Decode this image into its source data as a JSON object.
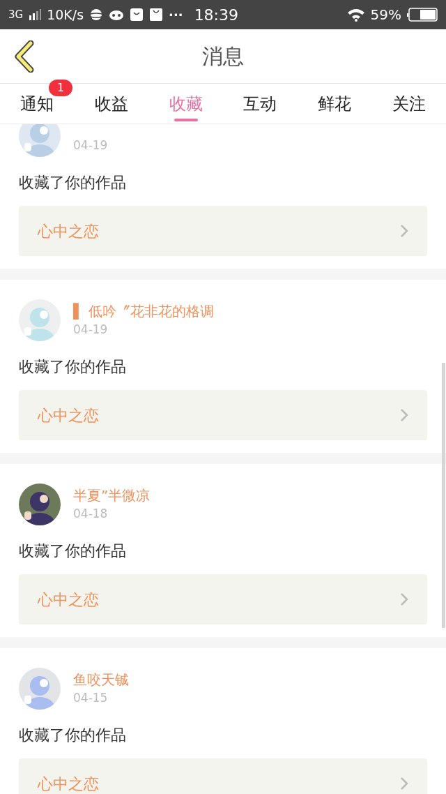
{
  "status_bar": {
    "network": "3G",
    "speed": "10K/s",
    "more": "···",
    "time": "18:39",
    "battery": "59%"
  },
  "header": {
    "title": "消息"
  },
  "tabs": [
    {
      "label": "通知",
      "selected": false,
      "badge": "1"
    },
    {
      "label": "收益",
      "selected": false
    },
    {
      "label": "收藏",
      "selected": true
    },
    {
      "label": "互动",
      "selected": false
    },
    {
      "label": "鲜花",
      "selected": false
    },
    {
      "label": "关注",
      "selected": false
    }
  ],
  "messages": [
    {
      "date": "04-19",
      "action": "收藏了你的作品",
      "work": "心中之恋"
    },
    {
      "name": "▌ 低吟〞花非花的格调",
      "date": "04-19",
      "action": "收藏了你的作品",
      "work": "心中之恋"
    },
    {
      "name": "半夏”半微凉",
      "date": "04-18",
      "action": "收藏了你的作品",
      "work": "心中之恋"
    },
    {
      "name": "鱼咬天铖",
      "date": "04-15",
      "action": "收藏了你的作品",
      "work": "心中之恋"
    }
  ]
}
